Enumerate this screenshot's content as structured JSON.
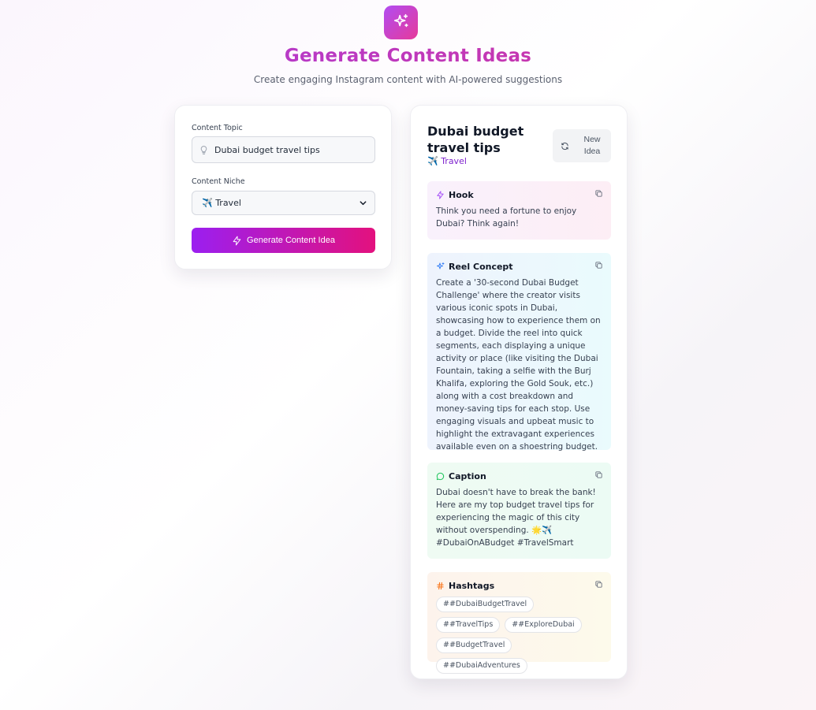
{
  "header": {
    "title": "Generate Content Ideas",
    "subtitle": "Create engaging Instagram content with AI-powered suggestions",
    "logo_icon": "sparkles-icon"
  },
  "form": {
    "topic_label": "Content Topic",
    "topic_value": "Dubai budget travel tips",
    "topic_icon": "lightbulb-icon",
    "niche_label": "Content Niche",
    "niche_selected": "✈️ Travel",
    "generate_label": "Generate Content Idea",
    "generate_icon": "lightning-icon"
  },
  "result": {
    "title": "Dubai budget travel tips",
    "niche": "✈️ Travel",
    "new_idea_label": "New Idea",
    "new_idea_icon": "refresh-icon",
    "sections": {
      "hook": {
        "title": "Hook",
        "icon": "lightning-icon",
        "body": "Think you need a fortune to enjoy Dubai? Think again!"
      },
      "reel": {
        "title": "Reel Concept",
        "icon": "sparkles-icon",
        "body": "Create a '30-second Dubai Budget Challenge' where the creator visits various iconic spots in Dubai, showcasing how to experience them on a budget. Divide the reel into quick segments, each displaying a unique activity or place (like visiting the Dubai Fountain, taking a selfie with the Burj Khalifa, exploring the Gold Souk, etc.) along with a cost breakdown and money-saving tips for each stop. Use engaging visuals and upbeat music to highlight the extravagant experiences available even on a shoestring budget."
      },
      "caption": {
        "title": "Caption",
        "icon": "chat-bubble-icon",
        "body": "Dubai doesn't have to break the bank! Here are my top budget travel tips for experiencing the magic of this city without overspending. 🌟✈️ #DubaiOnABudget #TravelSmart"
      },
      "hashtags": {
        "title": "Hashtags",
        "icon": "hash-icon",
        "tags": [
          "##DubaiBudgetTravel",
          "##TravelTips",
          "##ExploreDubai",
          "##BudgetTravel",
          "##DubaiAdventures"
        ]
      }
    }
  },
  "colors": {
    "accent_start": "#9b1ff0",
    "accent_end": "#e3117e",
    "niche_text": "#7e22ce"
  }
}
